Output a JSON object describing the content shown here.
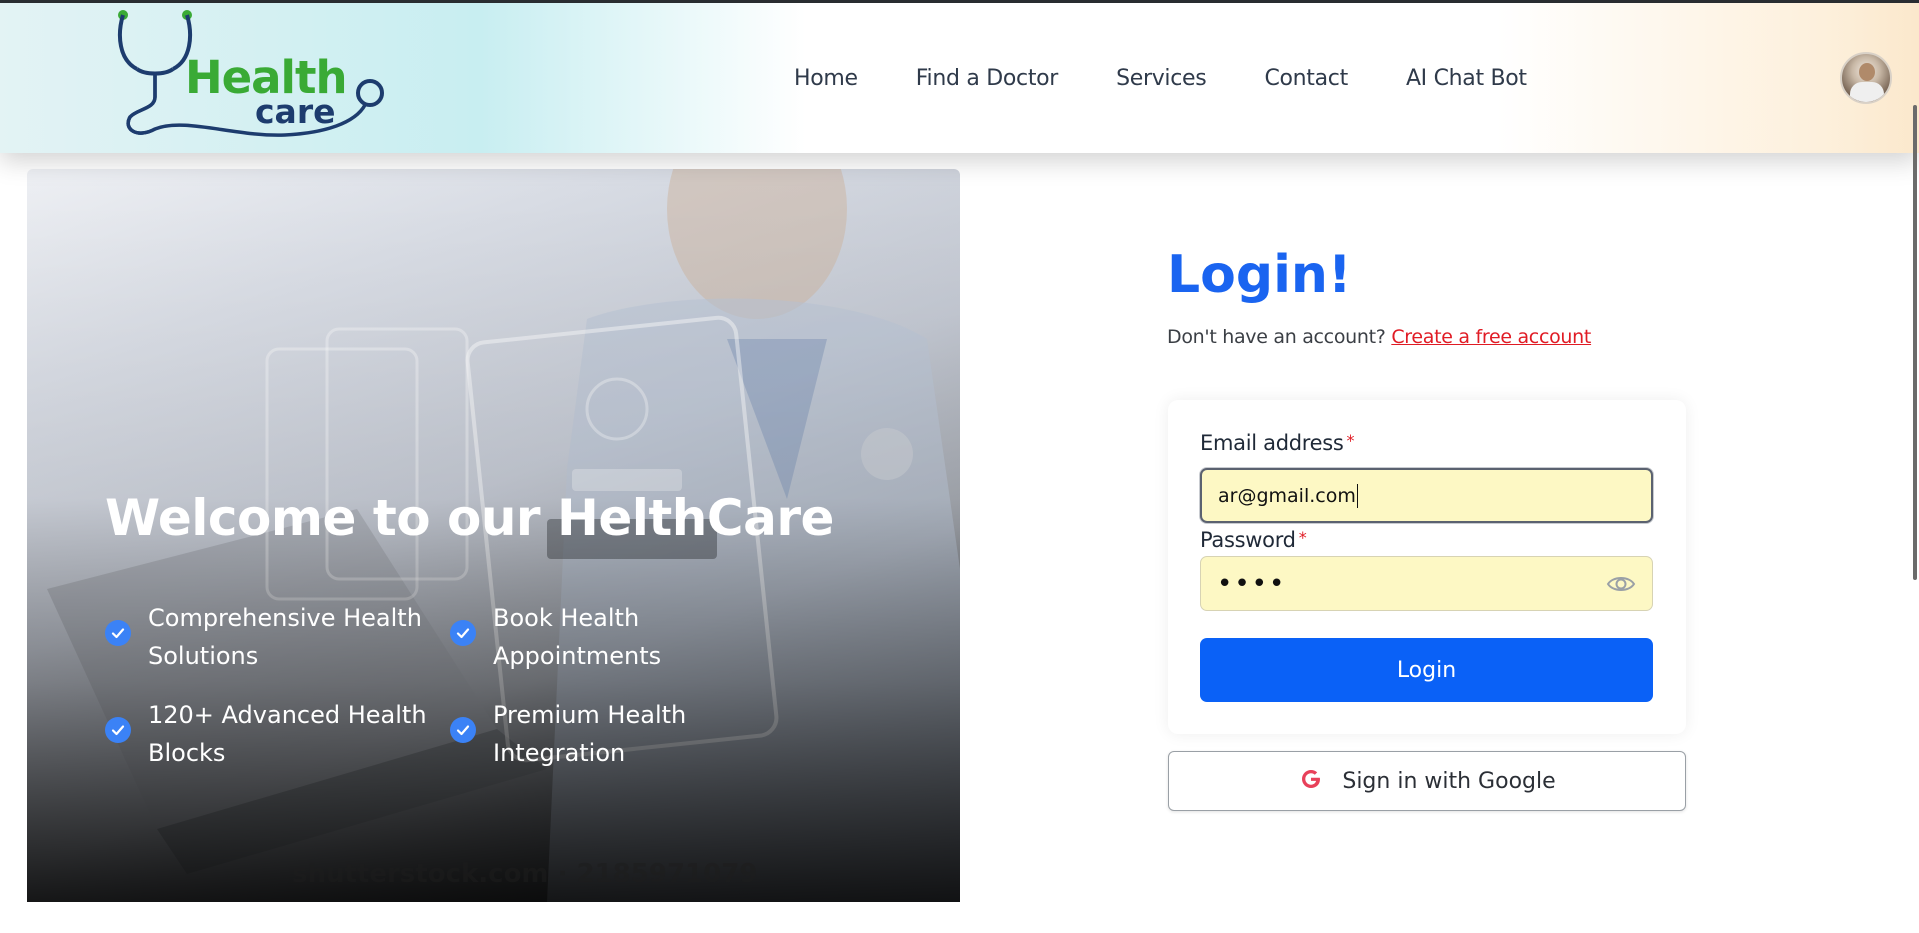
{
  "header": {
    "logo": {
      "word1": "Health",
      "word2": "care"
    },
    "nav": [
      "Home",
      "Find a Doctor",
      "Services",
      "Contact",
      "AI Chat Bot"
    ]
  },
  "hero": {
    "title": "Welcome to our HelthCare",
    "features": [
      "Comprehensive Health Solutions",
      "Book Health Appointments",
      "120+ Advanced Health Blocks",
      "Premium Health Integration"
    ],
    "feature_lines": [
      [
        "Comprehensive Health",
        "Solutions"
      ],
      [
        "Book Health",
        "Appointments"
      ],
      [
        "120+ Advanced Health",
        "Blocks"
      ],
      [
        "Premium Health",
        "Integration"
      ]
    ],
    "watermark": "shutterstock.com · 2185971079"
  },
  "login": {
    "title": "Login!",
    "signup_prompt": "Don't have an account? ",
    "signup_link": "Create a free account",
    "email_label": "Email address",
    "email_value": "ar@gmail.com",
    "password_label": "Password",
    "password_mask": "••••",
    "required_mark": "*",
    "submit_label": "Login",
    "google_label": "Sign in with Google"
  },
  "colors": {
    "primary": "#0a61f7",
    "title_blue": "#1a64f0",
    "link_red": "#e01b24",
    "check_blue": "#3b82f6",
    "input_autofill": "#fdf8c4",
    "logo_green": "#3aaa35",
    "logo_navy": "#1d3c6e"
  },
  "icons": [
    "stethoscope-logo-icon",
    "check-icon",
    "eye-icon",
    "google-icon",
    "user-avatar"
  ]
}
